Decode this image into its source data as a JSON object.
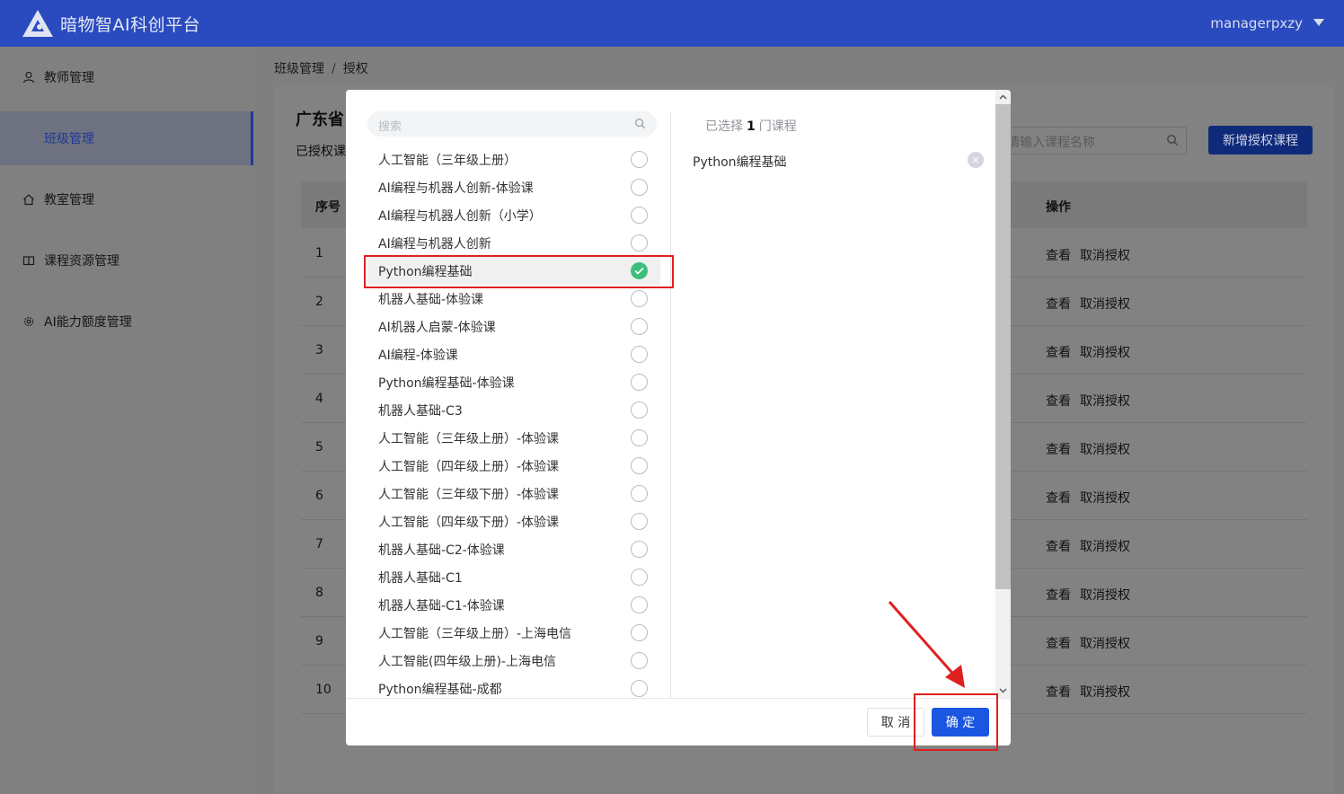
{
  "header": {
    "app_title": "暗物智AI科创平台",
    "user_name": "managerpxzy",
    "logo": "app-logo",
    "dropdown_icon": "caret-down-icon"
  },
  "sidebar": {
    "items": [
      {
        "label": "教师管理",
        "icon": "user-icon"
      },
      {
        "label": "班级管理",
        "icon": "",
        "active": true
      },
      {
        "label": "教室管理",
        "icon": "home-icon"
      },
      {
        "label": "课程资源管理",
        "icon": "book-icon"
      },
      {
        "label": "AI能力额度管理",
        "icon": "gear-icon"
      }
    ]
  },
  "breadcrumb": {
    "parent": "班级管理",
    "separator": "/",
    "current": "授权"
  },
  "main": {
    "title_partial": "广东省",
    "subtitle_partial": "已授权课",
    "search_placeholder": "请输入课程名称",
    "add_button": "新增授权课程",
    "table": {
      "headers": {
        "index": "序号",
        "actions": "操作"
      },
      "rows": [
        "1",
        "2",
        "3",
        "4",
        "5",
        "6",
        "7",
        "8",
        "9",
        "10"
      ],
      "action_view": "查看",
      "action_revoke": "取消授权"
    }
  },
  "modal": {
    "search_placeholder": "搜索",
    "courses": [
      {
        "name": "人工智能（三年级上册）",
        "selected": false
      },
      {
        "name": "AI编程与机器人创新-体验课",
        "selected": false
      },
      {
        "name": "AI编程与机器人创新（小学）",
        "selected": false
      },
      {
        "name": "AI编程与机器人创新",
        "selected": false
      },
      {
        "name": "Python编程基础",
        "selected": true
      },
      {
        "name": "机器人基础-体验课",
        "selected": false
      },
      {
        "name": "AI机器人启蒙-体验课",
        "selected": false
      },
      {
        "name": "AI编程-体验课",
        "selected": false
      },
      {
        "name": "Python编程基础-体验课",
        "selected": false
      },
      {
        "name": "机器人基础-C3",
        "selected": false
      },
      {
        "name": "人工智能（三年级上册）-体验课",
        "selected": false
      },
      {
        "name": "人工智能（四年级上册）-体验课",
        "selected": false
      },
      {
        "name": "人工智能（三年级下册）-体验课",
        "selected": false
      },
      {
        "name": "人工智能（四年级下册）-体验课",
        "selected": false
      },
      {
        "name": "机器人基础-C2-体验课",
        "selected": false
      },
      {
        "name": "机器人基础-C1",
        "selected": false
      },
      {
        "name": "机器人基础-C1-体验课",
        "selected": false
      },
      {
        "name": "人工智能（三年级上册）-上海电信",
        "selected": false
      },
      {
        "name": "人工智能(四年级上册)-上海电信",
        "selected": false
      },
      {
        "name": "Python编程基础-成都",
        "selected": false
      }
    ],
    "selected_prefix": "已选择",
    "selected_count": "1",
    "selected_suffix": "门课程",
    "selected_items": [
      "Python编程基础"
    ],
    "cancel_button": "取 消",
    "ok_button": "确 定"
  },
  "colors": {
    "header_bg": "#2a4bbf",
    "primary": "#1a56e0",
    "checked": "#3cbf7a",
    "annotation": "#e02020"
  }
}
